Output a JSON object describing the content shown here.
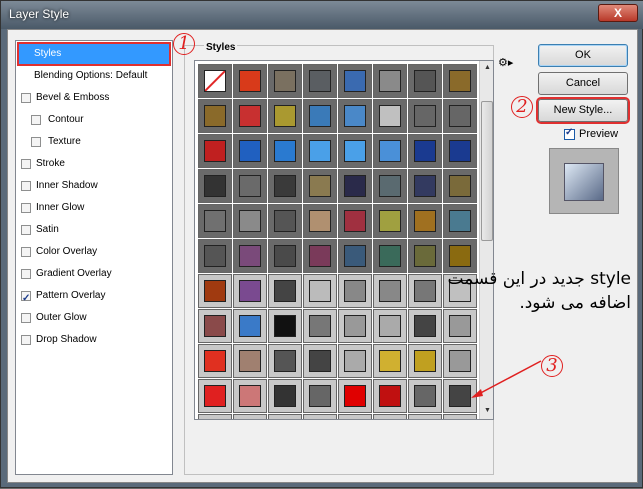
{
  "window": {
    "title": "Layer Style",
    "close_label": "X"
  },
  "left": {
    "items": [
      {
        "label": "Styles",
        "selected": true,
        "checkbox": false
      },
      {
        "label": "Blending Options: Default",
        "selected": false,
        "checkbox": false
      },
      {
        "label": "Bevel & Emboss",
        "checked": false
      },
      {
        "label": "Contour",
        "checked": false,
        "sub": true
      },
      {
        "label": "Texture",
        "checked": false,
        "sub": true
      },
      {
        "label": "Stroke",
        "checked": false
      },
      {
        "label": "Inner Shadow",
        "checked": false
      },
      {
        "label": "Inner Glow",
        "checked": false
      },
      {
        "label": "Satin",
        "checked": false
      },
      {
        "label": "Color Overlay",
        "checked": false
      },
      {
        "label": "Gradient Overlay",
        "checked": false
      },
      {
        "label": "Pattern Overlay",
        "checked": true
      },
      {
        "label": "Outer Glow",
        "checked": false
      },
      {
        "label": "Drop Shadow",
        "checked": false
      }
    ]
  },
  "styles_group": {
    "label": "Styles"
  },
  "swatch_colors": [
    [
      "#ffffff",
      "#d83a1a",
      "#7a7060",
      "#5a5e62",
      "#3a6ab0",
      "#8a8a8a",
      "#555",
      "#8a6a2a"
    ],
    [
      "#8a6a2a",
      "#c83030",
      "#aa9930",
      "#3a7ab8",
      "#4a88c8",
      "#c0c0c0",
      "#666",
      "#666"
    ],
    [
      "#c02020",
      "#2060c0",
      "#2a7ad0",
      "#4aa0e8",
      "#4aa0e8",
      "#4a90d8",
      "#1a3a90",
      "#1a3a90"
    ],
    [
      "#333",
      "#6a6a6a",
      "#3a3a3a",
      "#8a7a50",
      "#2a2a4a",
      "#5a6a70",
      "#333a60",
      "#7a6a3a"
    ],
    [
      "#707070",
      "#8a8a8a",
      "#555",
      "#b09070",
      "#a03040",
      "#a0a040",
      "#a07020",
      "#4a7a90"
    ],
    [
      "#555",
      "#7a4a7a",
      "#4a4a4a",
      "#7a3a5a",
      "#3a5a7a",
      "#3a6a5a",
      "#6a6a3a",
      "#8a6a10"
    ],
    [
      "#a03a10",
      "#7a4a90",
      "#444",
      "#bbb",
      "#888",
      "#888",
      "#777",
      "#c0c0c0"
    ],
    [
      "#8a4a4a",
      "#3a7ac8",
      "#111",
      "#777",
      "#999",
      "#aaa",
      "#444",
      "#999"
    ],
    [
      "#e03020",
      "#a08070",
      "#555",
      "#444",
      "#aaa",
      "#d0b030",
      "#c0a020",
      "#999"
    ],
    [
      "#e02020",
      "#cc7777",
      "#333",
      "#666",
      "#e00000",
      "#c01010",
      "#666",
      "#444"
    ],
    [
      "#c0b080",
      "#666",
      "#c04040",
      "#e00000",
      "#aa3030",
      "#c03030",
      "#444",
      "#888"
    ]
  ],
  "buttons": {
    "ok": "OK",
    "cancel": "Cancel",
    "new_style": "New Style..."
  },
  "preview": {
    "label": "Preview",
    "checked": true
  },
  "annotations": {
    "n1": "1",
    "n2": "2",
    "n3": "3",
    "note": "style جدید در این قسمت اضافه می شود.",
    "accent": "#e02020"
  }
}
